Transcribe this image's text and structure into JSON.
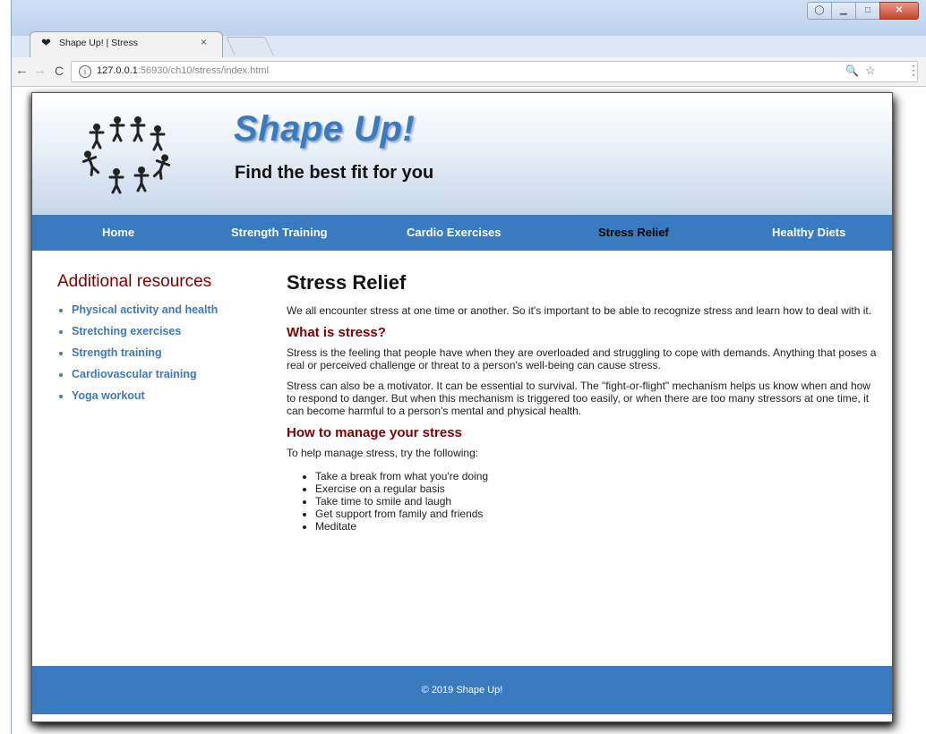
{
  "browser": {
    "tab": {
      "title": "Shape Up! | Stress",
      "favicon": "heart-icon",
      "close": "×"
    },
    "nav": {
      "back": "←",
      "forward": "→",
      "reload": "C"
    },
    "address": {
      "info": "i",
      "host": "127.0.0.1",
      "rest": ":56930/ch10/stress/index.html"
    },
    "icons": {
      "zoom": "zoom-icon",
      "star": "bookmark-star-icon",
      "menu": "menu-icon"
    },
    "menu_glyph": "⋮",
    "zoom_glyph": "🔍",
    "star_glyph": "☆"
  },
  "site": {
    "title": "Shape Up!",
    "subtitle": "Find the best fit for you",
    "nav": [
      "Home",
      "Strength Training",
      "Cardio Exercises",
      "Stress Relief",
      "Healthy Diets"
    ],
    "current": "Stress Relief"
  },
  "aside": {
    "heading": "Additional resources",
    "links": [
      "Physical activity and health",
      "Stretching exercises",
      "Strength training",
      "Cardiovascular training",
      "Yoga workout"
    ]
  },
  "article": {
    "title": "Stress Relief",
    "intro": "We all encounter stress at one time or another. So it's important to be able to recognize stress and learn how to deal with it.",
    "h2_1": "What is stress?",
    "p1": "Stress is the feeling that people have when they are overloaded and struggling to cope with demands. Anything that poses a real or perceived challenge or threat to a person's well-being can cause stress.",
    "p2": "Stress can also be a motivator. It can be essential to survival. The \"fight-or-flight\" mechanism helps us know when and how to respond to danger. But when this mechanism is triggered too easily, or when there are too many stressors at one time, it can become harmful to a person's mental and physical health.",
    "h2_2": "How to manage your stress",
    "p3": "To help manage stress, try the following:",
    "tips": [
      "Take a break from what you're doing",
      "Exercise on a regular basis",
      "Take time to smile and laugh",
      "Get support from family and friends",
      "Meditate"
    ]
  },
  "footer": {
    "text": "© 2019 Shape Up!"
  },
  "colors": {
    "brand_blue": "#3a7bbf",
    "heading_red": "#800000"
  }
}
